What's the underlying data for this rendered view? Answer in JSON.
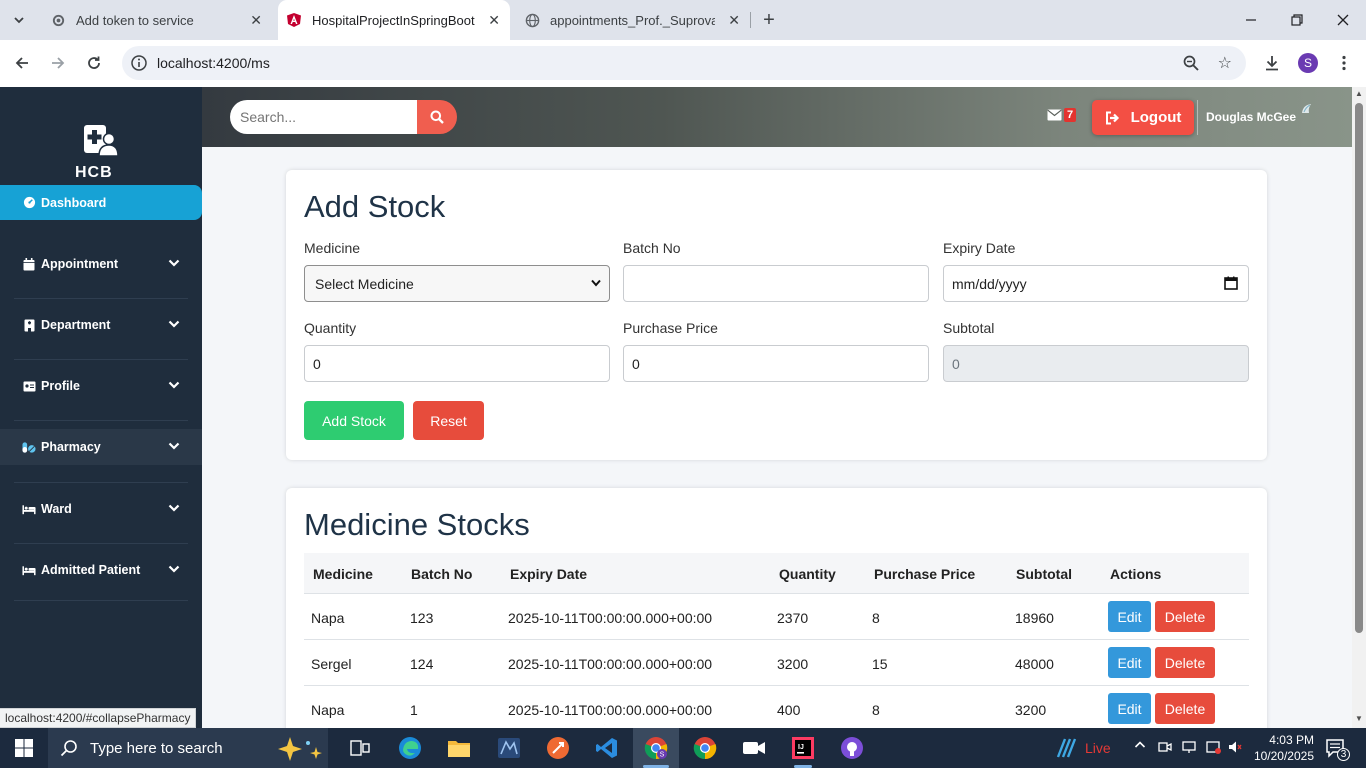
{
  "browser": {
    "tabs": [
      {
        "title": "Add token to service"
      },
      {
        "title": "HospitalProjectInSpringBoot"
      },
      {
        "title": "appointments_Prof._Suprova_Sh"
      }
    ],
    "url": "localhost:4200/ms",
    "profile_initial": "S",
    "status_url": "localhost:4200/#collapsePharmacy"
  },
  "app": {
    "brand": "HCB",
    "search_placeholder": "Search...",
    "mail_count": "7",
    "logout_label": "Logout",
    "user_name": "Douglas McGee",
    "sidebar": [
      {
        "label": "Dashboard"
      },
      {
        "label": "Appointment"
      },
      {
        "label": "Department"
      },
      {
        "label": "Profile"
      },
      {
        "label": "Pharmacy"
      },
      {
        "label": "Ward"
      },
      {
        "label": "Admitted Patient"
      }
    ]
  },
  "add_stock": {
    "title": "Add Stock",
    "medicine_label": "Medicine",
    "medicine_value": "Select Medicine",
    "batch_label": "Batch No",
    "batch_value": "",
    "expiry_label": "Expiry Date",
    "expiry_placeholder": "mm/dd/yyyy",
    "quantity_label": "Quantity",
    "quantity_value": "0",
    "price_label": "Purchase Price",
    "price_value": "0",
    "subtotal_label": "Subtotal",
    "subtotal_value": "0",
    "add_button": "Add Stock",
    "reset_button": "Reset"
  },
  "stocks": {
    "title": "Medicine Stocks",
    "columns": [
      "Medicine",
      "Batch No",
      "Expiry Date",
      "Quantity",
      "Purchase Price",
      "Subtotal",
      "Actions"
    ],
    "rows": [
      {
        "medicine": "Napa",
        "batch": "123",
        "expiry": "2025-10-11T00:00:00.000+00:00",
        "quantity": "2370",
        "price": "8",
        "subtotal": "18960"
      },
      {
        "medicine": "Sergel",
        "batch": "124",
        "expiry": "2025-10-11T00:00:00.000+00:00",
        "quantity": "3200",
        "price": "15",
        "subtotal": "48000"
      },
      {
        "medicine": "Napa",
        "batch": "1",
        "expiry": "2025-10-11T00:00:00.000+00:00",
        "quantity": "400",
        "price": "8",
        "subtotal": "3200"
      }
    ],
    "edit_label": "Edit",
    "delete_label": "Delete"
  },
  "taskbar": {
    "search_placeholder": "Type here to search",
    "weather_label": "Live",
    "time": "4:03 PM",
    "date": "10/20/2025",
    "notification_count": "3"
  }
}
